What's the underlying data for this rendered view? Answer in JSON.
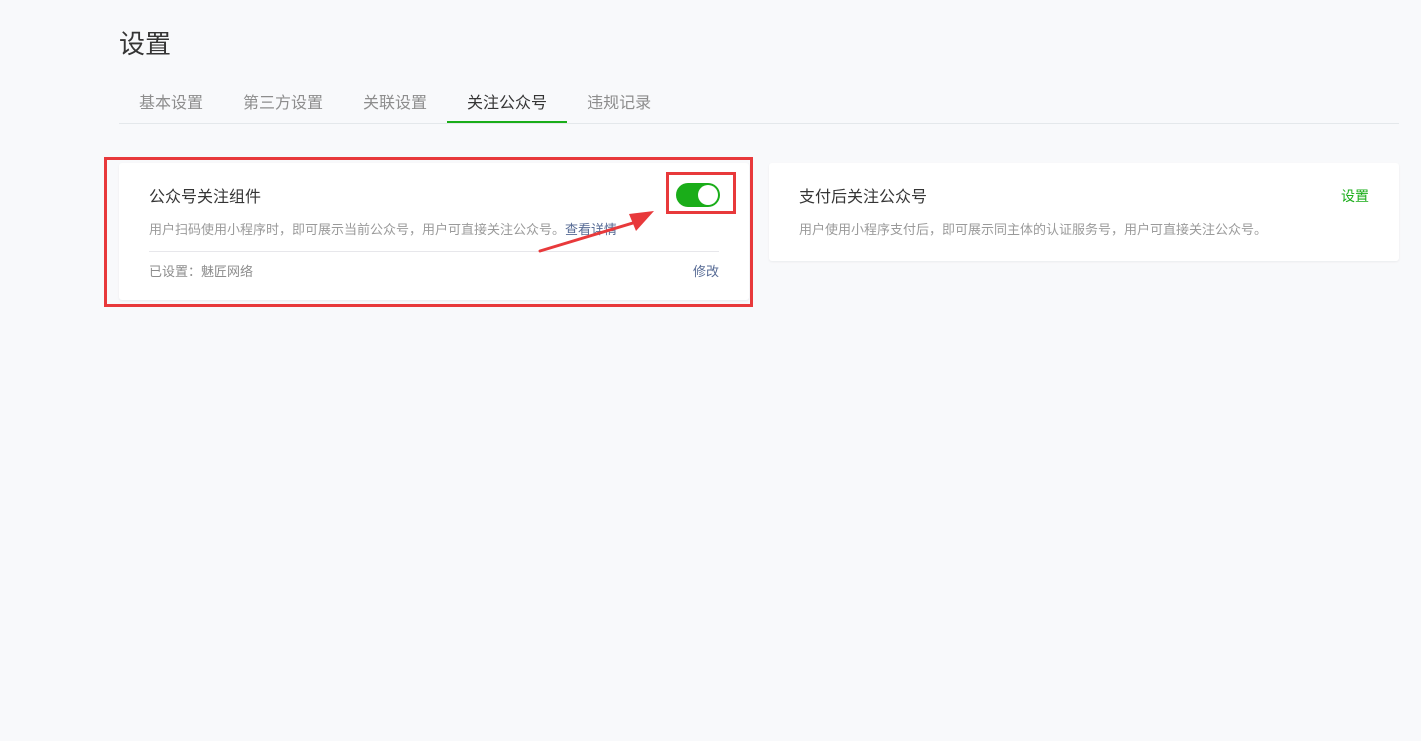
{
  "page": {
    "title": "设置"
  },
  "tabs": [
    {
      "label": "基本设置",
      "active": false
    },
    {
      "label": "第三方设置",
      "active": false
    },
    {
      "label": "关联设置",
      "active": false
    },
    {
      "label": "关注公众号",
      "active": true
    },
    {
      "label": "违规记录",
      "active": false
    }
  ],
  "follow_component": {
    "title": "公众号关注组件",
    "description": "用户扫码使用小程序时，即可展示当前公众号，用户可直接关注公众号。",
    "detail_link": "查看详情",
    "toggle_on": true,
    "status_text": "已设置：魅匠网络",
    "modify_label": "修改"
  },
  "pay_follow": {
    "title": "支付后关注公众号",
    "description": "用户使用小程序支付后，即可展示同主体的认证服务号，用户可直接关注公众号。",
    "set_label": "设置"
  },
  "colors": {
    "accent_green": "#1aad19",
    "link_blue": "#576b95",
    "annotation_red": "#e8393b",
    "background": "#f8f9fb"
  },
  "icons": {
    "toggle": "toggle-switch-on",
    "annotation": "red-arrow-annotation"
  }
}
